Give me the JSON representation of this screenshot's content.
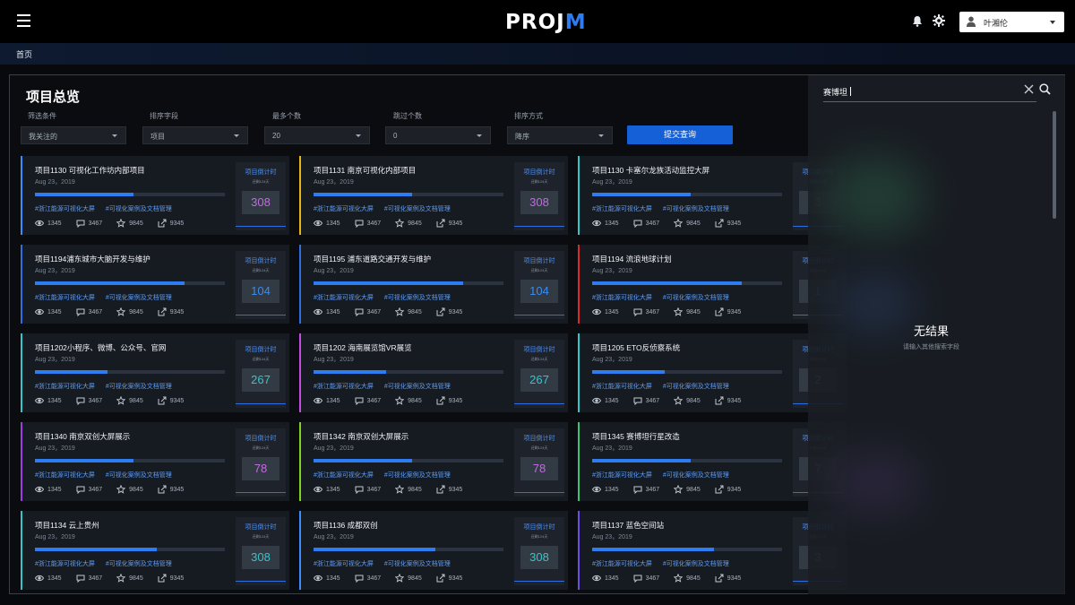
{
  "app": {
    "logo_main": "PROJ",
    "logo_accent": "M",
    "user": "叶湘伦"
  },
  "breadcrumb": "首页",
  "page_title": "项目总览",
  "filters": [
    {
      "label": "筛选条件",
      "value": "我关注的"
    },
    {
      "label": "排序字段",
      "value": "项目"
    },
    {
      "label": "最多个数",
      "value": "20"
    },
    {
      "label": "跳过个数",
      "value": "0"
    },
    {
      "label": "排序方式",
      "value": "降序"
    }
  ],
  "submit_label": "提交查询",
  "card_common": {
    "date": "Aug 23，2019",
    "tags": [
      "#浙江能源可视化大屏",
      "#可视化案例及文档管理"
    ],
    "stats": {
      "views": "1345",
      "comments": "3467",
      "stars": "9845",
      "shares": "9345"
    },
    "countdown_label": "项目倒计时",
    "countdown_sub": "还剩124天"
  },
  "cards": [
    {
      "title": "项目1130  可视化工作坊内部项目",
      "progress": 0.52,
      "countdown": "308",
      "accent": "#3b8cff",
      "num_color": "#c36be0"
    },
    {
      "title": "项目1131  南京可视化内部项目",
      "progress": 0.52,
      "countdown": "308",
      "accent": "#e8b317",
      "num_color": "#c36be0"
    },
    {
      "title": "项目1130  卡塞尔龙族活动监控大屏",
      "progress": 0.52,
      "countdown": "3",
      "accent": "#34c6c9",
      "num_color": "#c36be0"
    },
    {
      "title": "项目1194浦东城市大脑开发与维护",
      "progress": 0.79,
      "countdown": "104",
      "accent": "#2e6ee0",
      "num_color": "#3a8cf0"
    },
    {
      "title": "项目1195 浦东道路交通开发与维护",
      "progress": 0.79,
      "countdown": "104",
      "accent": "#2e6ee0",
      "num_color": "#3a8cf0"
    },
    {
      "title": "项目1194 流浪地球计划",
      "progress": 0.79,
      "countdown": "1",
      "accent": "#d42b2b",
      "num_color": "#3a8cf0"
    },
    {
      "title": "项目1202小程序、微博、公众号、官网",
      "progress": 0.38,
      "countdown": "267",
      "accent": "#34c6c9",
      "num_color": "#3cc3c9"
    },
    {
      "title": "项目1202 海南展览馆VR展览",
      "progress": 0.38,
      "countdown": "267",
      "accent": "#c64be0",
      "num_color": "#3cc3c9"
    },
    {
      "title": "项目1205 ETO反侦察系统",
      "progress": 0.38,
      "countdown": "2",
      "accent": "#34c6c9",
      "num_color": "#3cc3c9"
    },
    {
      "title": "项目1340  南京双创大屏展示",
      "progress": 0.52,
      "countdown": "78",
      "accent": "#9b3fe0",
      "num_color": "#c36be0"
    },
    {
      "title": "项目1342  南京双创大屏展示",
      "progress": 0.52,
      "countdown": "78",
      "accent": "#7ed321",
      "num_color": "#c36be0"
    },
    {
      "title": "项目1345  赛博坦行星改造",
      "progress": 0.52,
      "countdown": "7",
      "accent": "#3cc37a",
      "num_color": "#c36be0"
    },
    {
      "title": "项目1134  云上贵州",
      "progress": 0.64,
      "countdown": "308",
      "accent": "#34c6c9",
      "num_color": "#3cc3c9"
    },
    {
      "title": "项目1136  成都双创",
      "progress": 0.64,
      "countdown": "308",
      "accent": "#3b8cff",
      "num_color": "#3cc3c9"
    },
    {
      "title": "项目1137  蓝色空间站",
      "progress": 0.64,
      "countdown": "3",
      "accent": "#6b4fe0",
      "num_color": "#3cc3c9"
    }
  ],
  "search": {
    "query": "赛博坦",
    "no_result": "无结果",
    "hint": "请输入其他搜索字段"
  }
}
